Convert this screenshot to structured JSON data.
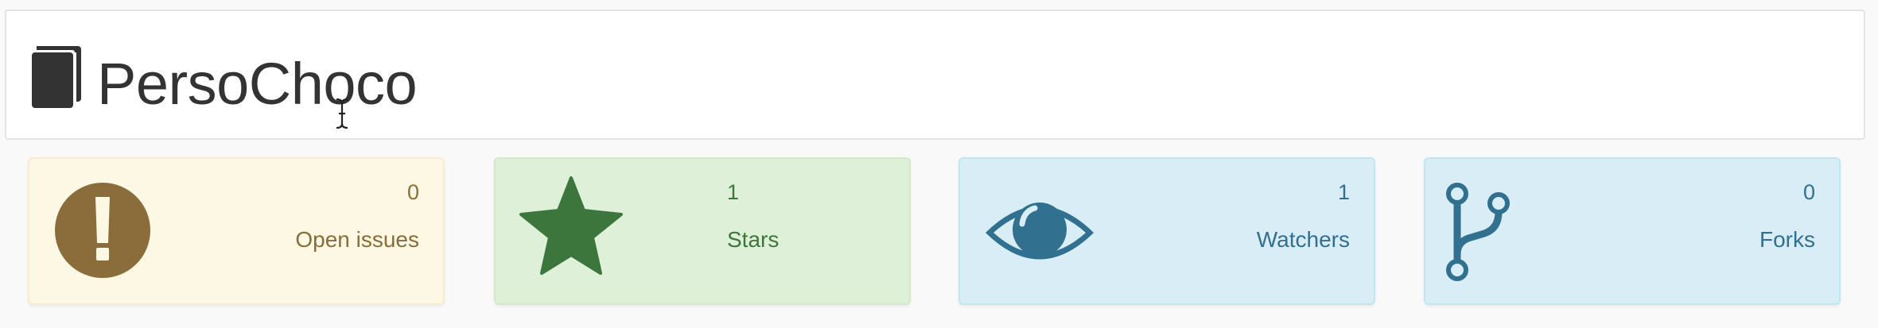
{
  "repo": {
    "title": "PersoChoco",
    "icon": "book-icon"
  },
  "stats": [
    {
      "id": "issues",
      "count": "0",
      "label": "Open issues",
      "icon": "exclamation-circle-icon",
      "color": "#8a6d3b",
      "background": "#fcf8e3"
    },
    {
      "id": "stars",
      "count": "1",
      "label": "Stars",
      "icon": "star-icon",
      "color": "#3c763d",
      "background": "#dff0d8"
    },
    {
      "id": "watchers",
      "count": "1",
      "label": "Watchers",
      "icon": "eye-icon",
      "color": "#31708f",
      "background": "#d9edf7"
    },
    {
      "id": "forks",
      "count": "0",
      "label": "Forks",
      "icon": "fork-icon",
      "color": "#31708f",
      "background": "#d9edf7"
    }
  ]
}
